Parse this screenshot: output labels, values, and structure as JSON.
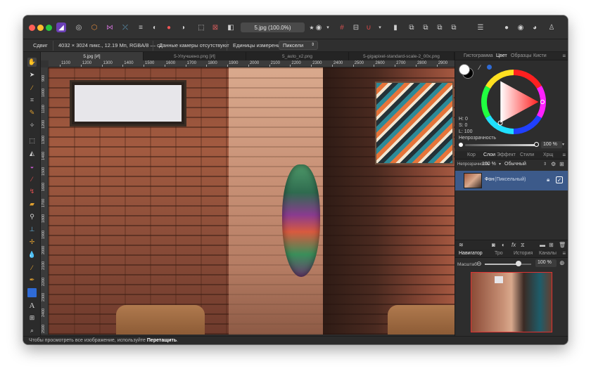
{
  "document_title": "5.jpg (100.0%)",
  "context_bar": {
    "tool": "Сдвиг",
    "image_info": "4032 × 3024 пикс., 12.19 Мп, RGBA/8 — c2",
    "camera": "Данные камеры отсутствуют",
    "units_label": "Единицы измерений:",
    "units_value": "Пиксели"
  },
  "doc_tabs": [
    {
      "label": "5.jpg [И]",
      "active": true
    },
    {
      "label": "5-Улучшено.png [И]",
      "active": false
    },
    {
      "label": "5_auto_x2.png",
      "active": false
    },
    {
      "label": "5-gigapixel-standard-scale-2_00x.png",
      "active": false
    }
  ],
  "ruler": {
    "top": [
      "1100",
      "1200",
      "1300",
      "1400",
      "1500",
      "1600",
      "1700",
      "1800",
      "1900",
      "2000",
      "2100",
      "2200",
      "2300",
      "2400",
      "2500",
      "2600",
      "2700",
      "2800",
      "2900"
    ],
    "left": [
      "900",
      "1000",
      "1100",
      "1200",
      "1300",
      "1400",
      "1500",
      "1600",
      "1700",
      "1800",
      "1900",
      "2000",
      "2100",
      "2200",
      "2300",
      "2400",
      "2500"
    ]
  },
  "color_panel": {
    "tabs": [
      "Гистограмма",
      "Цвет",
      "Образцы",
      "Кисти"
    ],
    "active_tab": "Цвет",
    "h": "H: 0",
    "s": "S: 0",
    "l": "L: 100",
    "opacity_label": "Непрозрачность",
    "opacity_value": "100 %"
  },
  "layers_panel": {
    "tabs": [
      "Кор",
      "Слои",
      "Эффект",
      "Стили",
      "Хрщ"
    ],
    "active_tab": "Слои",
    "opacity_label": "Непрозрачность",
    "opacity_value": "100 %",
    "blend_mode": "Обычный",
    "layer_name": "Фон",
    "layer_type": "(Пиксельный)"
  },
  "navigator_panel": {
    "tabs": [
      "Навигатор",
      "Тро",
      "История",
      "Каналы"
    ],
    "active_tab": "Навигатор",
    "zoom_label": "Масштаб",
    "zoom_value": "100 %",
    "zoom_fraction": 0.72
  },
  "status": {
    "prefix": "Чтобы просмотреть все изображение, используйте",
    "action": "Перетащить",
    "suffix": "."
  },
  "colors": {
    "accent_blue": "#2f6bd6",
    "selected_layer": "#3c5a8a",
    "primary_swatch": "#ffffff",
    "secondary_swatch": "#000000"
  }
}
